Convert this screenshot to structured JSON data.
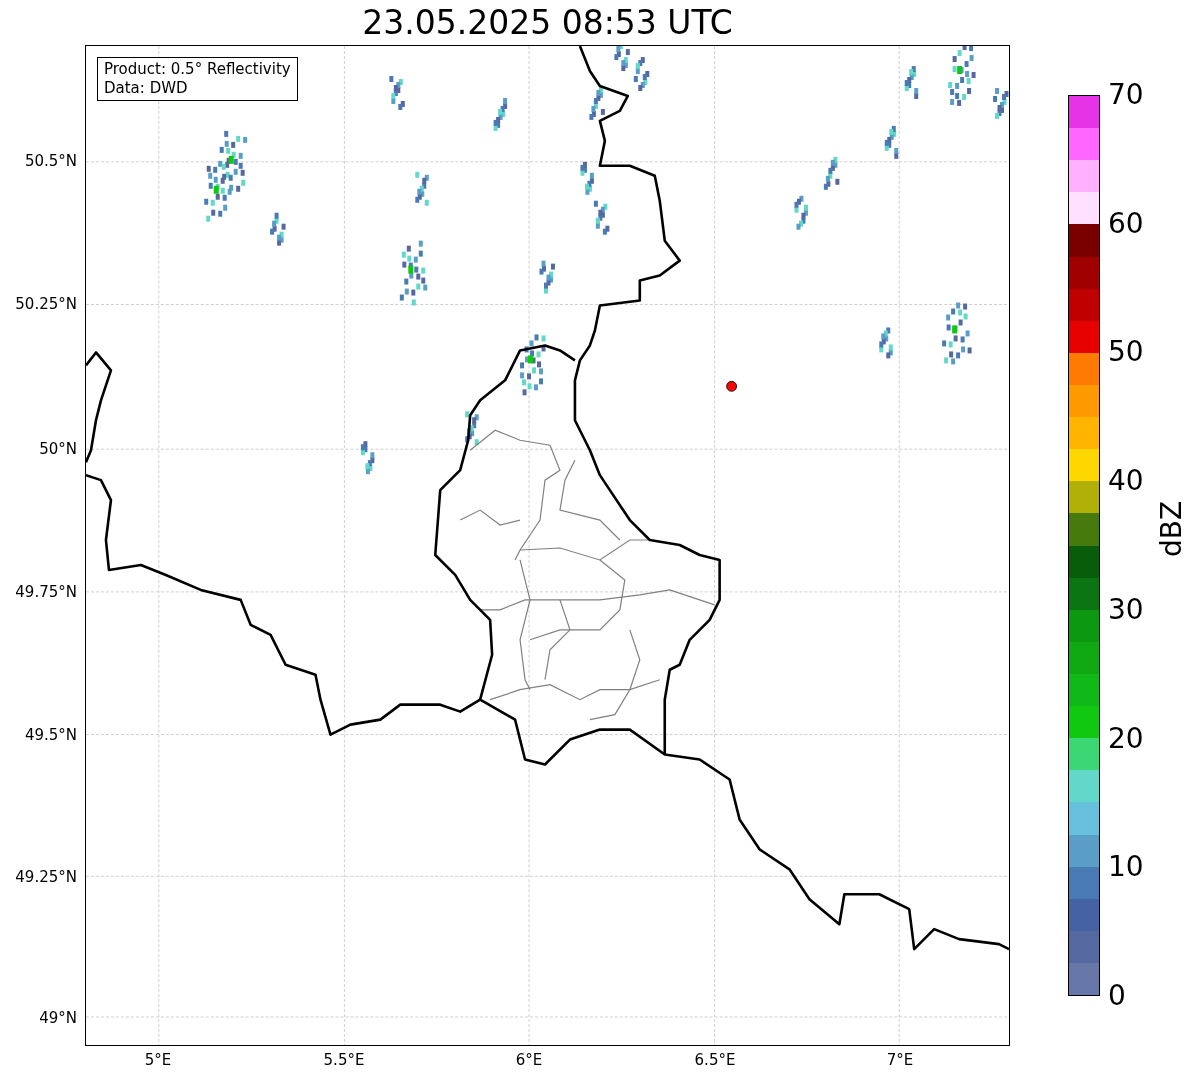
{
  "title": "23.05.2025 08:53 UTC",
  "map": {
    "legend": [
      "Product: 0.5° Reflectivity",
      "Data: DWD"
    ],
    "y_ticks": [
      "50.5°N",
      "50.25°N",
      "50°N",
      "49.75°N",
      "49.5°N",
      "49.25°N",
      "49°N"
    ],
    "x_ticks": [
      "5°E",
      "5.5°E",
      "6°E",
      "6.5°E",
      "7°E"
    ]
  },
  "colorbar": {
    "label": "dBZ",
    "ticks": [
      "70",
      "60",
      "50",
      "40",
      "30",
      "20",
      "10",
      "0"
    ],
    "bands": [
      {
        "color": "#e633e6"
      },
      {
        "color": "#ff66ff"
      },
      {
        "color": "#ffb0ff"
      },
      {
        "color": "#ffe0ff"
      },
      {
        "color": "#7a0000"
      },
      {
        "color": "#a00000"
      },
      {
        "color": "#c00000"
      },
      {
        "color": "#e60000"
      },
      {
        "color": "#ff7a00"
      },
      {
        "color": "#ff9900"
      },
      {
        "color": "#ffb400"
      },
      {
        "color": "#ffd700"
      },
      {
        "color": "#b0b008"
      },
      {
        "color": "#467a0c"
      },
      {
        "color": "#075d0a"
      },
      {
        "color": "#0a7512"
      },
      {
        "color": "#0d9812"
      },
      {
        "color": "#0fa812"
      },
      {
        "color": "#10b818"
      },
      {
        "color": "#11c811"
      },
      {
        "color": "#3dd674"
      },
      {
        "color": "#62d8c8"
      },
      {
        "color": "#66c0dc"
      },
      {
        "color": "#5a9ec8"
      },
      {
        "color": "#4a7ab3"
      },
      {
        "color": "#4562a3"
      },
      {
        "color": "#5569a0"
      },
      {
        "color": "#6677a8"
      }
    ]
  }
}
